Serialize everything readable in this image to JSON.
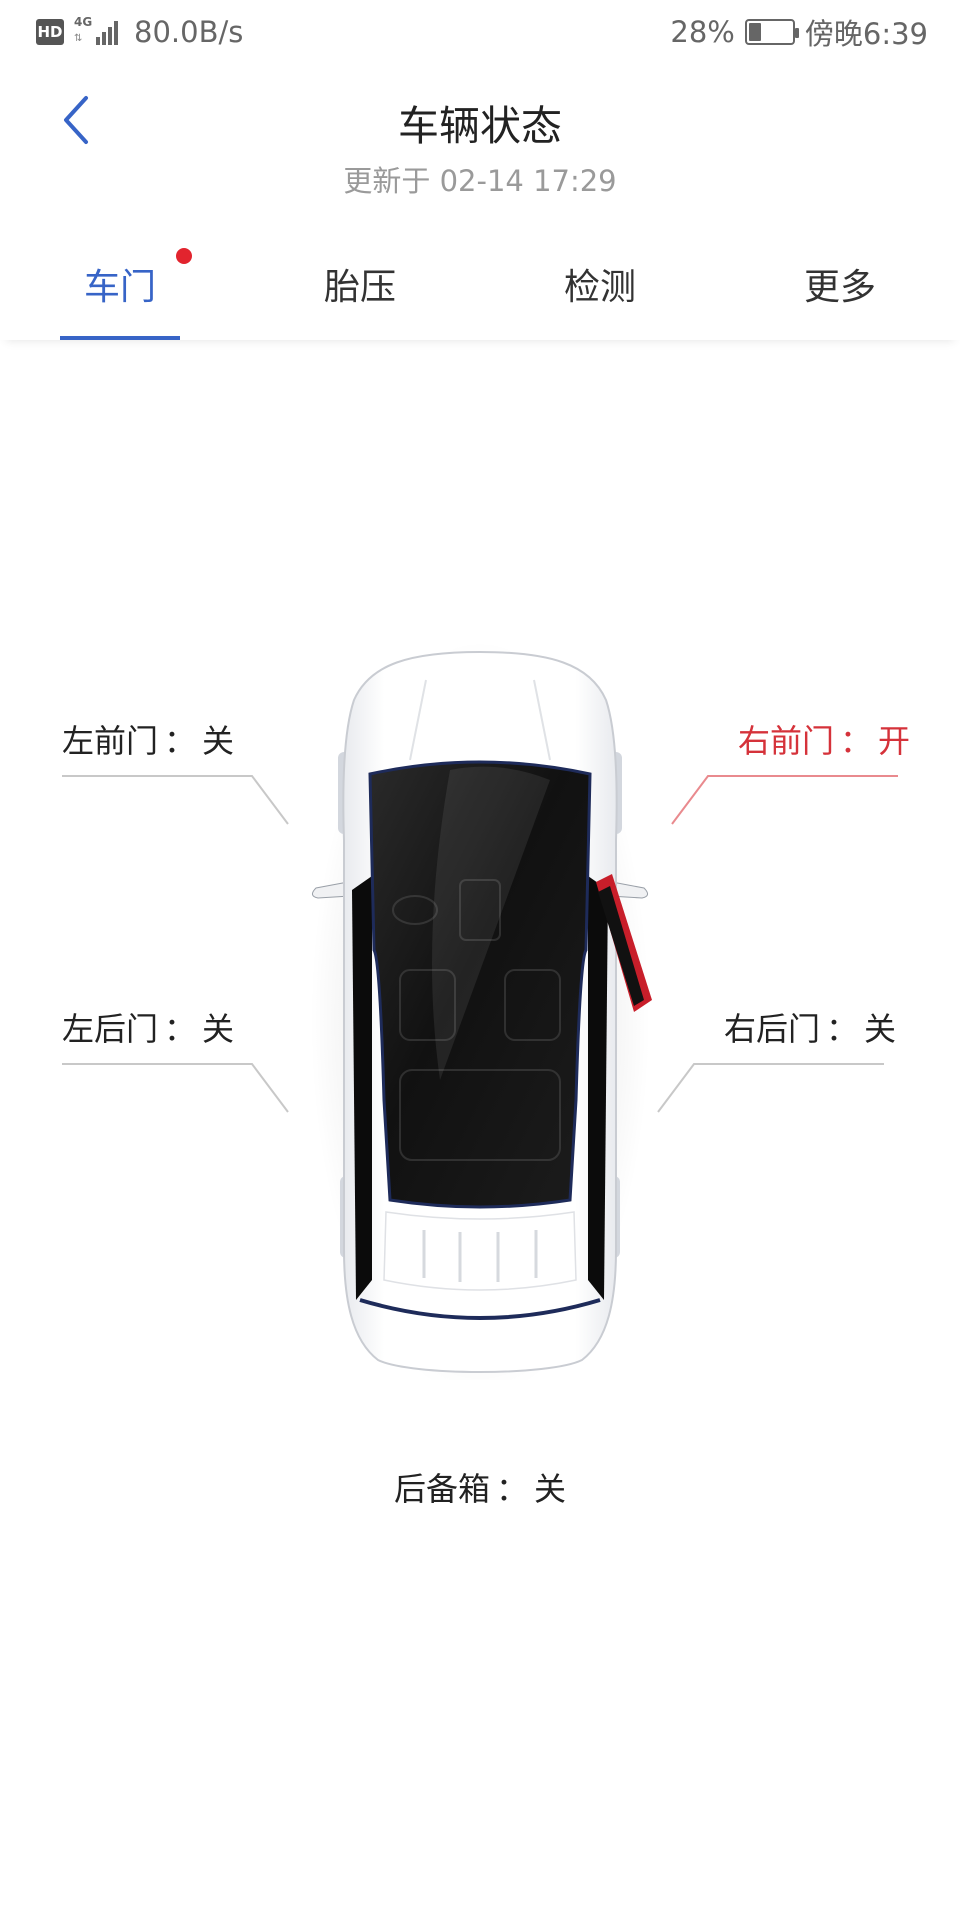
{
  "status_bar": {
    "hd": "HD",
    "network": "4G",
    "speed": "80.0B/s",
    "battery_percent": "28%",
    "battery_level": 0.28,
    "time": "傍晚6:39"
  },
  "header": {
    "title": "车辆状态",
    "subtitle": "更新于 02-14 17:29"
  },
  "tabs": [
    {
      "label": "车门",
      "active": true,
      "badge": true
    },
    {
      "label": "胎压",
      "active": false,
      "badge": false
    },
    {
      "label": "检测",
      "active": false,
      "badge": false
    },
    {
      "label": "更多",
      "active": false,
      "badge": false
    }
  ],
  "doors": {
    "left_front": {
      "name": "左前门",
      "sep": "：",
      "state": "关"
    },
    "right_front": {
      "name": "右前门",
      "sep": "：",
      "state": "开"
    },
    "left_rear": {
      "name": "左后门",
      "sep": "：",
      "state": "关"
    },
    "right_rear": {
      "name": "右后门",
      "sep": "：",
      "state": "关"
    },
    "trunk": {
      "name": "后备箱",
      "sep": "：",
      "state": "关"
    }
  },
  "colors": {
    "accent": "#3764c7",
    "alert": "#d5323a",
    "badge": "#e2242e"
  }
}
